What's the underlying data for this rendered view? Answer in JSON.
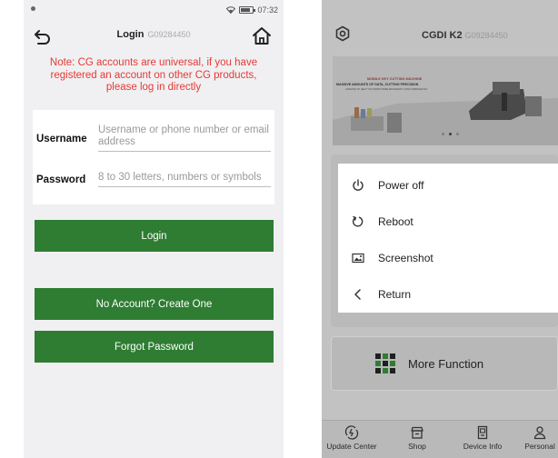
{
  "login_screen": {
    "status_bar": {
      "time": "07:32",
      "battery_level": 0.8
    },
    "title": "Login",
    "serial": "G09284450",
    "notice": "Note: CG accounts are universal, if you have registered an account on other CG products, please log in directly",
    "username": {
      "label": "Username",
      "placeholder": "Username or phone number or email address"
    },
    "password": {
      "label": "Password",
      "placeholder": "8 to 30 letters, numbers or symbols"
    },
    "login_button": "Login",
    "create_account_button": "No Account? Create One",
    "forgot_password_button": "Forgot Password",
    "icons": {
      "back": "back-arrow-icon",
      "home": "home-icon"
    },
    "colors": {
      "accent_green": "#2e7d32",
      "notice_red": "#e53935",
      "background": "#f0f0f2"
    }
  },
  "device_screen": {
    "title": "CGDI K2",
    "serial": "G09284450",
    "banner": {
      "line1": "MOBILE KEY CUTTING MACHINE",
      "line2": "MASSIVE AMOUNTS OF DATA, CUTTING PRECISION",
      "line3": "A DEVICE TO HELP YOU WORK MORE EFFICIENTLY FOR A SIMPLER KEY",
      "active_slide": 2,
      "slide_count": 3
    },
    "power_menu": [
      {
        "label": "Power off",
        "icon": "power-icon"
      },
      {
        "label": "Reboot",
        "icon": "reboot-icon"
      },
      {
        "label": "Screenshot",
        "icon": "screenshot-icon"
      },
      {
        "label": "Return",
        "icon": "chevron-left-icon"
      }
    ],
    "more_function": "More Function",
    "bottom_nav": [
      {
        "label": "Update Center",
        "icon": "update-icon"
      },
      {
        "label": "Shop",
        "icon": "shop-icon"
      },
      {
        "label": "Device Info",
        "icon": "device-info-icon"
      },
      {
        "label": "Personal",
        "icon": "person-icon"
      }
    ],
    "colors": {
      "overlay_gray": "#c2c2c2",
      "accent_green": "#2e7d32"
    }
  }
}
